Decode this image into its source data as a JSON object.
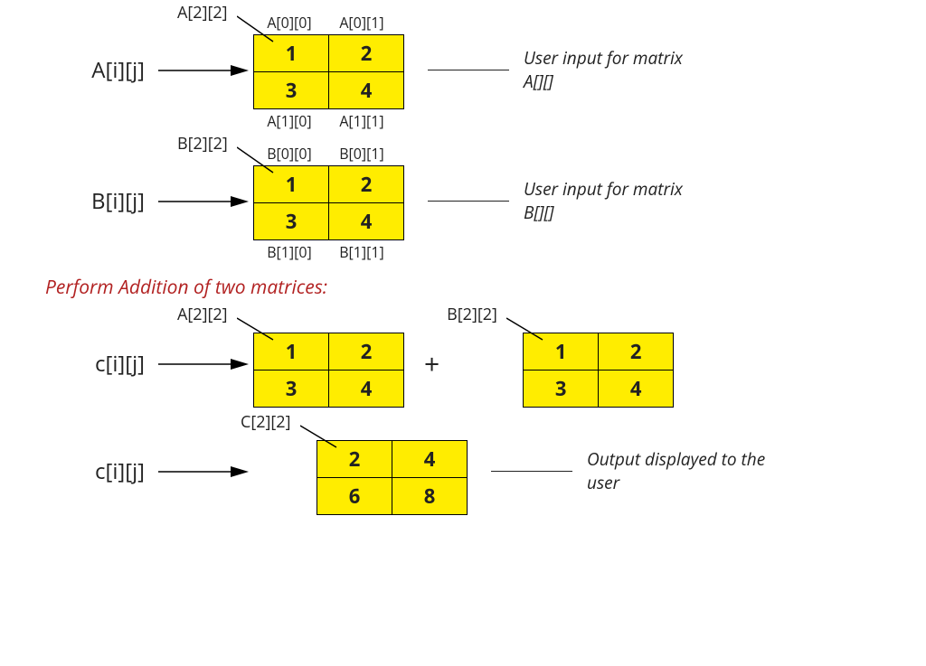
{
  "matrixA": {
    "varLabel": "A[i][j]",
    "dimLabel": "A[2][2]",
    "top": [
      "A[0][0]",
      "A[0][1]"
    ],
    "bottom": [
      "A[1][0]",
      "A[1][1]"
    ],
    "cells": [
      [
        "1",
        "2"
      ],
      [
        "3",
        "4"
      ]
    ],
    "desc": "User input for matrix A[][]"
  },
  "matrixB": {
    "varLabel": "B[i][j]",
    "dimLabel": "B[2][2]",
    "top": [
      "B[0][0]",
      "B[0][1]"
    ],
    "bottom": [
      "B[1][0]",
      "B[1][1]"
    ],
    "cells": [
      [
        "1",
        "2"
      ],
      [
        "3",
        "4"
      ]
    ],
    "desc": "User input for matrix B[][]"
  },
  "heading": "Perform Addition of two matrices:",
  "addition": {
    "varLabel": "c[i][j]",
    "leftDim": "A[2][2]",
    "leftCells": [
      [
        "1",
        "2"
      ],
      [
        "3",
        "4"
      ]
    ],
    "plus": "+",
    "rightDim": "B[2][2]",
    "rightCells": [
      [
        "1",
        "2"
      ],
      [
        "3",
        "4"
      ]
    ]
  },
  "result": {
    "varLabel": "c[i][j]",
    "dimLabel": "C[2][2]",
    "cells": [
      [
        "2",
        "4"
      ],
      [
        "6",
        "8"
      ]
    ],
    "desc": "Output displayed to the user"
  }
}
